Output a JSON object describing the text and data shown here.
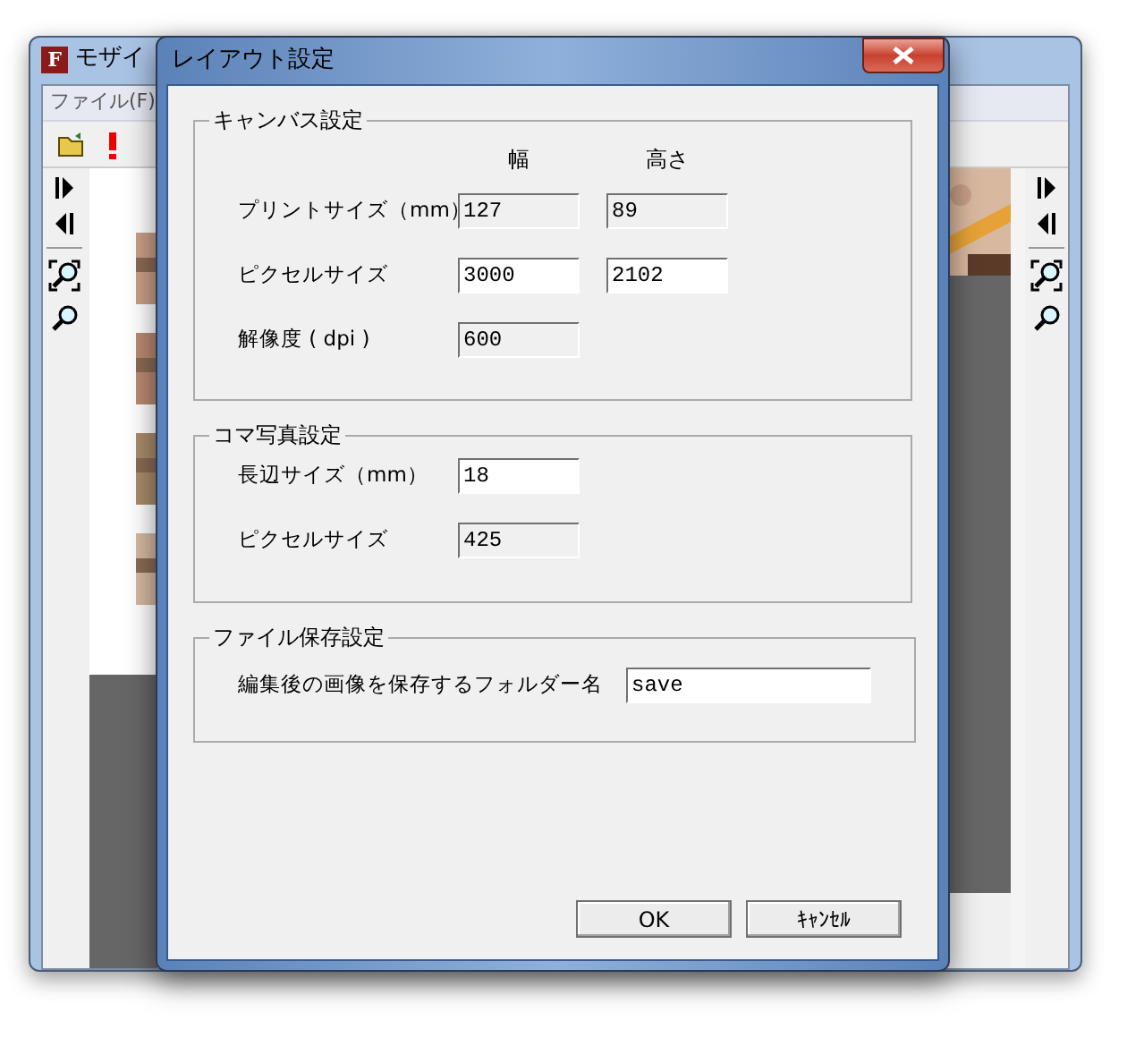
{
  "back_window": {
    "title": "モザイ",
    "icon_letter": "F",
    "menu": [
      "ファイル(F)"
    ]
  },
  "dialog": {
    "title": "レイアウト設定",
    "groups": [
      {
        "title": "キャンバス設定",
        "kind": "grid",
        "column_headers": [
          "幅",
          "高さ"
        ],
        "rows": [
          {
            "label": "プリントサイズ（mm）",
            "fields": [
              {
                "value": "127",
                "editable": false
              },
              {
                "value": "89",
                "editable": false
              }
            ]
          },
          {
            "label": "ピクセルサイズ",
            "fields": [
              {
                "value": "3000",
                "editable": true
              },
              {
                "value": "2102",
                "editable": true
              }
            ]
          },
          {
            "label": "解像度 ( dpi )",
            "fields": [
              {
                "value": "600",
                "editable": false
              }
            ]
          }
        ]
      },
      {
        "title": "コマ写真設定",
        "kind": "grid",
        "rows": [
          {
            "label": "長辺サイズ（mm）",
            "fields": [
              {
                "value": "18",
                "editable": true
              }
            ]
          },
          {
            "label": "ピクセルサイズ",
            "fields": [
              {
                "value": "425",
                "editable": false
              }
            ]
          }
        ]
      },
      {
        "title": "ファイル保存設定",
        "kind": "wide",
        "rows": [
          {
            "label": "編集後の画像を保存するフォルダー名",
            "fields": [
              {
                "value": "save",
                "editable": true
              }
            ]
          }
        ]
      }
    ],
    "buttons": [
      "OK",
      "ｷｬﾝｾﾙ"
    ]
  }
}
